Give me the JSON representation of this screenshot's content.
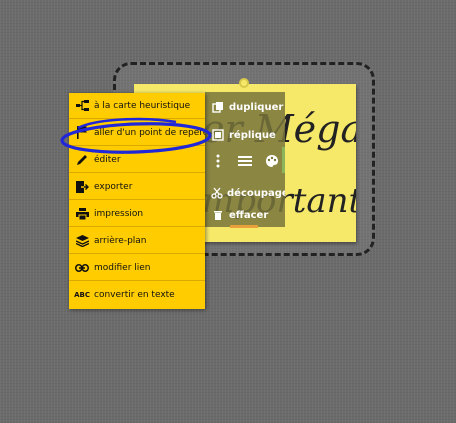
{
  "note": {
    "handwriting_line1": "er Méga",
    "handwriting_line2": "mportant"
  },
  "note_toolbar": {
    "items": [
      {
        "label": "dupliquer",
        "icon": "duplicate-icon"
      },
      {
        "label": "réplique",
        "icon": "reply-icon"
      },
      {
        "label": "découpage",
        "icon": "scissors-icon"
      },
      {
        "label": "effacer",
        "icon": "trash-icon"
      }
    ],
    "icon_row": [
      "more-vertical-icon",
      "menu-lines-icon",
      "palette-icon"
    ]
  },
  "context_menu": {
    "items": [
      {
        "label": "à la carte heuristique",
        "icon": "mindmap-icon"
      },
      {
        "label": "aller d'un point de repère",
        "icon": "flag-icon",
        "highlighted": true
      },
      {
        "label": "éditer",
        "icon": "pencil-icon"
      },
      {
        "label": "exporter",
        "icon": "export-icon"
      },
      {
        "label": "impression",
        "icon": "printer-icon"
      },
      {
        "label": "arrière-plan",
        "icon": "layers-icon"
      },
      {
        "label": "modifier lien",
        "icon": "link-icon"
      },
      {
        "label": "convertir en texte",
        "icon": "abc-icon",
        "icon_text": "ABC"
      }
    ]
  },
  "colors": {
    "menu_bg": "#ffcc00",
    "note_bg": "#f6e969",
    "annotation": "#1f27d8"
  }
}
